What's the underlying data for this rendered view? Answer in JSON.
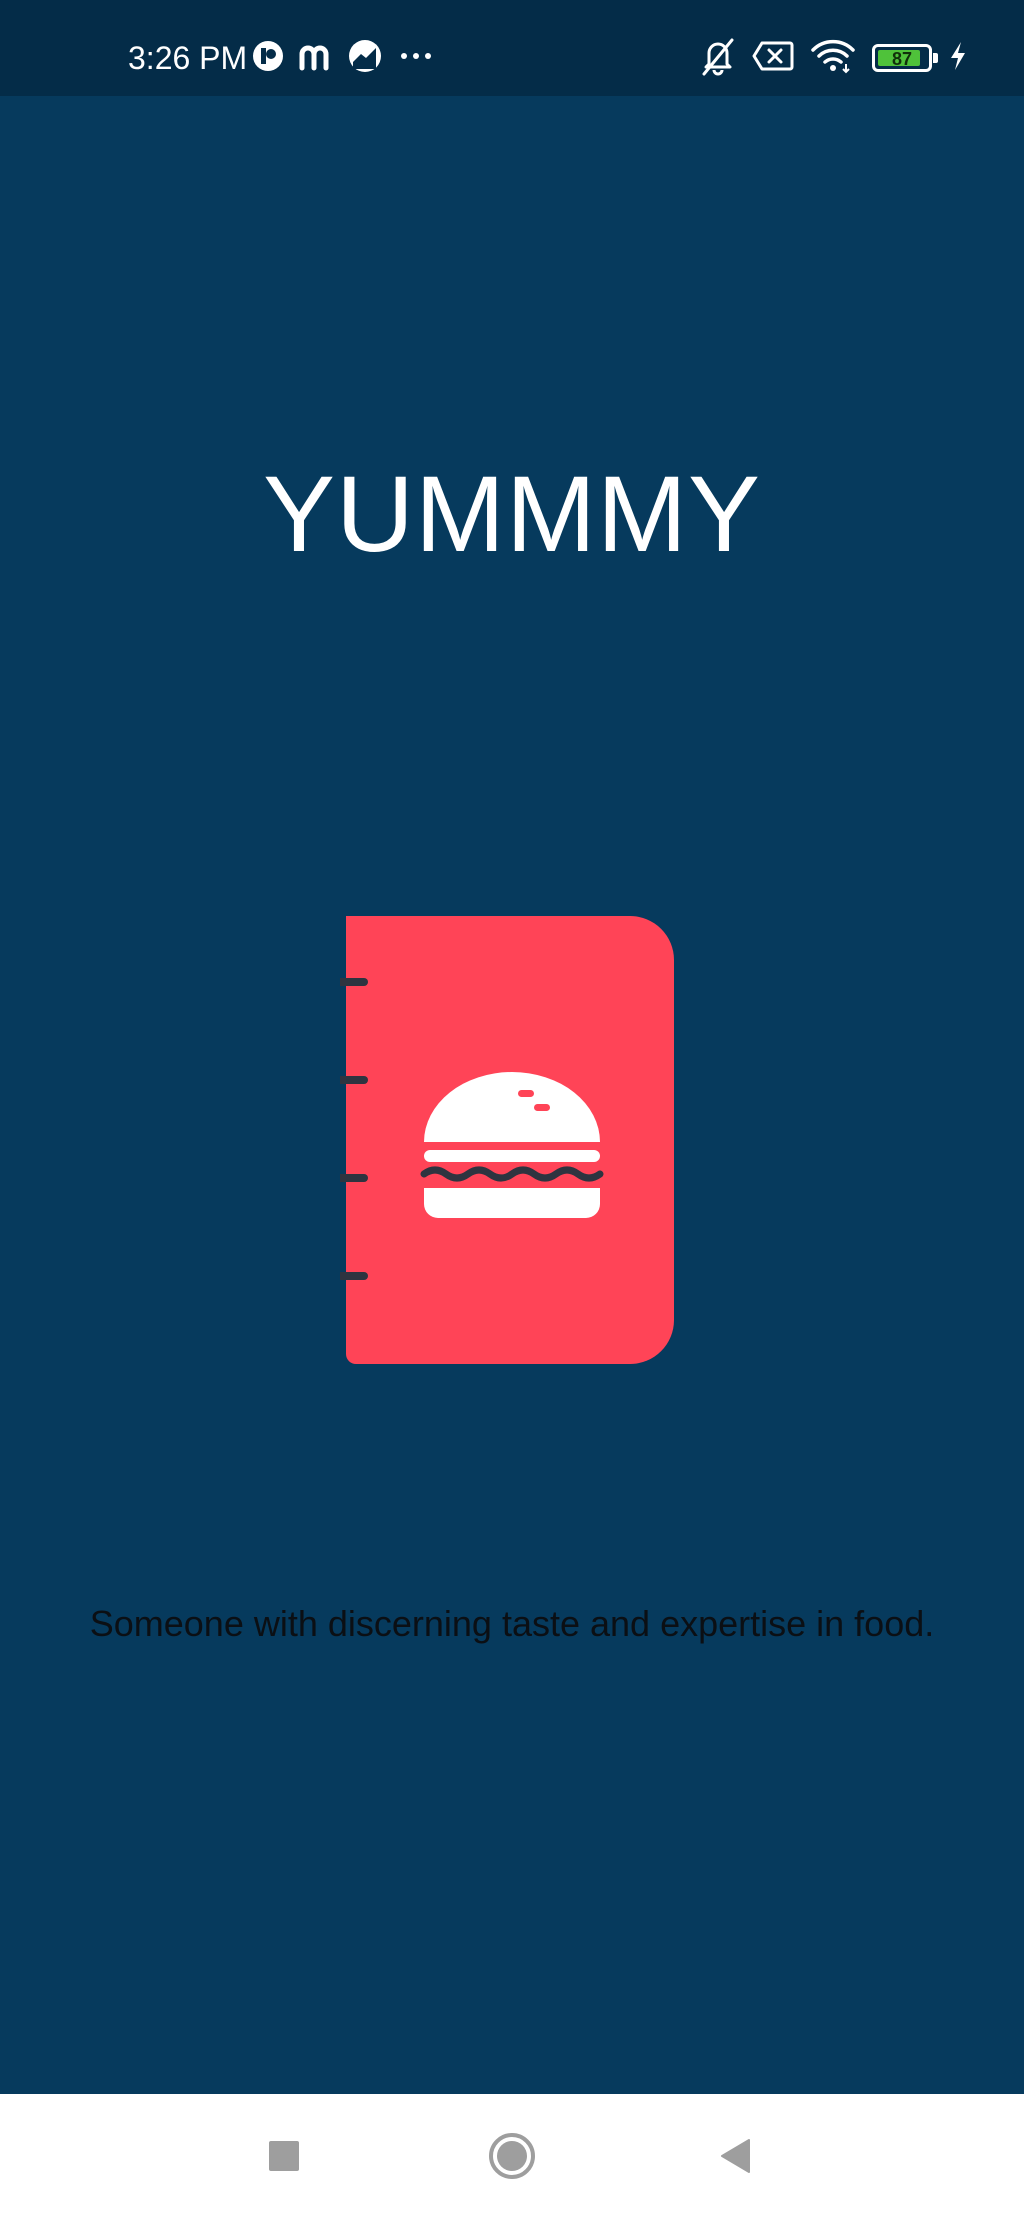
{
  "status_bar": {
    "time": "3:26 PM",
    "left_icons": [
      "app-icon-r",
      "app-icon-m",
      "app-icon-chart",
      "more-dots-icon"
    ],
    "right_icons": [
      "bell-off-icon",
      "sim-x-icon",
      "wifi-icon"
    ],
    "battery_level": "87",
    "battery_fraction": 0.87,
    "charging": true
  },
  "splash": {
    "title": "YUMMMY",
    "tagline": "Someone with discerning taste and expertise in food.",
    "logo": "burger-menu-book-icon"
  },
  "nav_bar": {
    "buttons": [
      "recents-square-icon",
      "home-circle-icon",
      "back-triangle-icon"
    ]
  },
  "colors": {
    "background": "#063a5d",
    "status_bar": "#042c48",
    "logo_red": "#ff4457",
    "title_text": "#ffffff",
    "tagline_text": "#0b0f14",
    "nav_background": "#ffffff",
    "nav_icon": "#9e9e9e"
  }
}
